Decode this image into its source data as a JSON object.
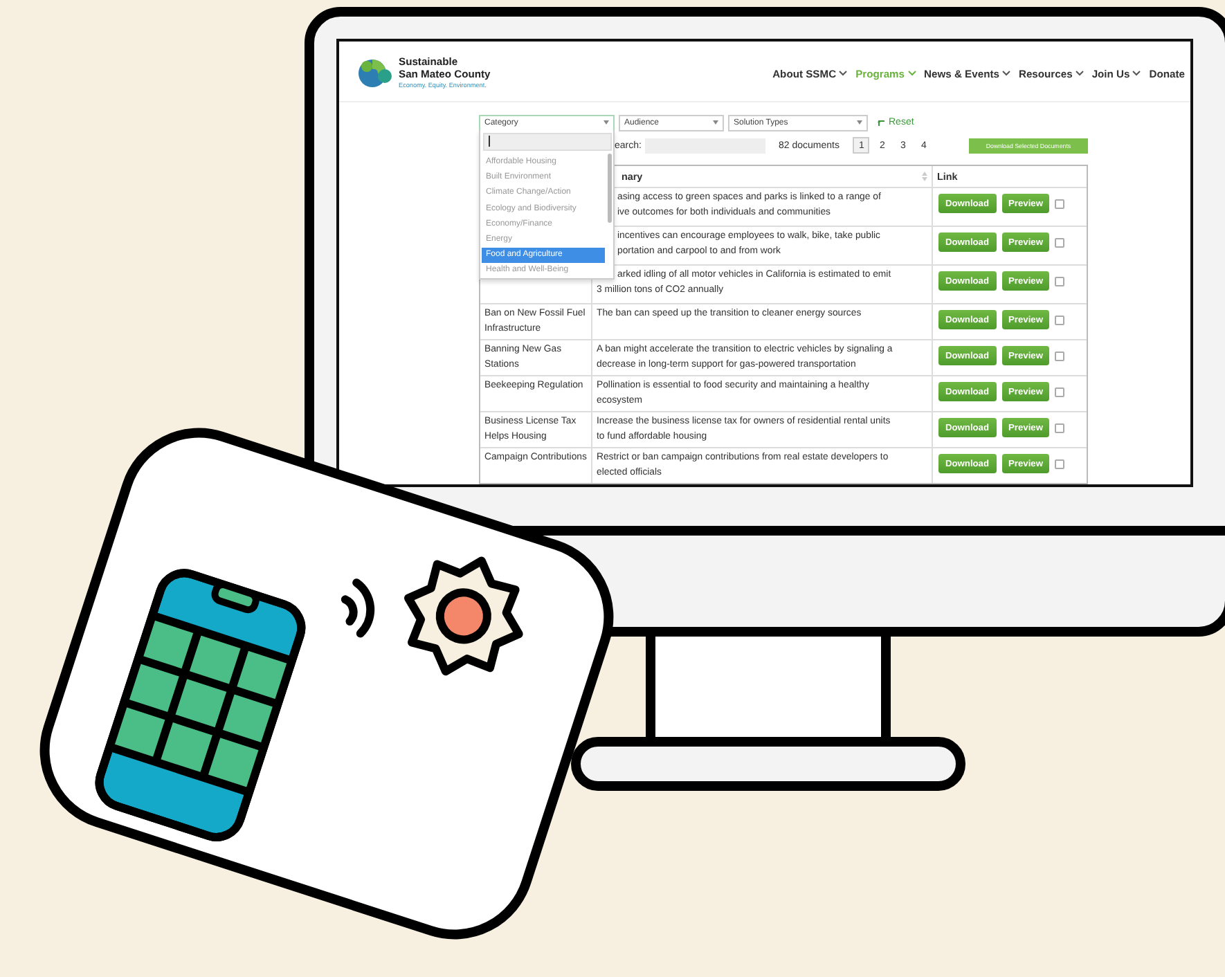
{
  "header": {
    "logo_lines": [
      "Sustainable",
      "San Mateo County"
    ],
    "tagline": "Economy. Equity. Environment.",
    "nav": [
      {
        "label": "About SSMC",
        "selected": false,
        "has_menu": true
      },
      {
        "label": "Programs",
        "selected": true,
        "has_menu": true
      },
      {
        "label": "News & Events",
        "selected": false,
        "has_menu": true
      },
      {
        "label": "Resources",
        "selected": false,
        "has_menu": true
      },
      {
        "label": "Join Us",
        "selected": false,
        "has_menu": true
      },
      {
        "label": "Donate",
        "selected": false,
        "has_menu": false
      }
    ]
  },
  "filters": {
    "selects": [
      {
        "label": "Category",
        "open": true,
        "options": [
          {
            "label": "Affordable Housing",
            "selected": false
          },
          {
            "label": "Built Environment",
            "selected": false
          },
          {
            "label": "Climate Change/Action",
            "selected": false
          },
          {
            "label": "Ecology and Biodiversity",
            "selected": false
          },
          {
            "label": "Economy/Finance",
            "selected": false
          },
          {
            "label": "Energy",
            "selected": false
          },
          {
            "label": "Food and Agriculture",
            "selected": true
          },
          {
            "label": "Health and Well-Being",
            "selected": false
          }
        ]
      },
      {
        "label": "Audience",
        "open": false
      },
      {
        "label": "Solution Types",
        "open": false
      }
    ],
    "reset": "Reset"
  },
  "search": {
    "label": "earch:"
  },
  "count": "82 documents",
  "pages": [
    {
      "label": "1",
      "selected": true
    },
    {
      "label": "2",
      "selected": false
    },
    {
      "label": "3",
      "selected": false
    },
    {
      "label": "4",
      "selected": false
    }
  ],
  "download_selected": "Download Selected Documents",
  "table": {
    "columns": [
      {
        "label": "nary",
        "kind": "clipped"
      },
      {
        "label": "Link",
        "kind": "full"
      }
    ],
    "rows": [
      {
        "summary": [
          {
            "text": "asing access to green spaces and parks is linked to a range of",
            "kind": "clipped"
          },
          {
            "text": "ive outcomes for both individuals and communities",
            "kind": "clipped"
          }
        ],
        "download": "Download",
        "preview": "Preview",
        "checked": false
      },
      {
        "summary": [
          {
            "text": "incentives can encourage employees to walk, bike, take public",
            "kind": "clipped"
          },
          {
            "text": "portation and carpool to and from work",
            "kind": "clipped"
          }
        ],
        "download": "Download",
        "preview": "Preview",
        "checked": false
      },
      {
        "summary": [
          {
            "text": "arked idling of all motor vehicles in California is estimated to emit",
            "kind": "clipped"
          },
          {
            "text": "3 million tons of CO2 annually",
            "kind": "full"
          }
        ],
        "download": "Download",
        "preview": "Preview",
        "checked": false
      },
      {
        "name": "Ban on New Fossil Fuel Infrastructure",
        "summary": [
          {
            "text": "The ban can speed up the transition to cleaner energy sources",
            "kind": "full"
          }
        ],
        "download": "Download",
        "preview": "Preview",
        "checked": false
      },
      {
        "name": "Banning New Gas Stations",
        "summary": [
          {
            "text": "A ban might accelerate the transition to electric vehicles by signaling a",
            "kind": "full"
          },
          {
            "text": "decrease in long-term support for gas-powered transportation",
            "kind": "full"
          }
        ],
        "download": "Download",
        "preview": "Preview",
        "checked": false
      },
      {
        "name": "Beekeeping Regulation",
        "summary": [
          {
            "text": "Pollination is essential to food security and maintaining a healthy",
            "kind": "full"
          },
          {
            "text": "ecosystem",
            "kind": "full"
          }
        ],
        "download": "Download",
        "preview": "Preview",
        "checked": false
      },
      {
        "name": "Business License Tax Helps Housing",
        "summary": [
          {
            "text": "Increase the business license tax for owners of residential rental units",
            "kind": "full"
          },
          {
            "text": "to fund affordable housing",
            "kind": "full"
          }
        ],
        "download": "Download",
        "preview": "Preview",
        "checked": false
      },
      {
        "name": "Campaign Contributions",
        "summary": [
          {
            "text": "Restrict or ban campaign contributions from real estate developers to",
            "kind": "full"
          },
          {
            "text": "elected officials",
            "kind": "full"
          }
        ],
        "download": "Download",
        "preview": "Preview",
        "checked": false
      }
    ]
  }
}
